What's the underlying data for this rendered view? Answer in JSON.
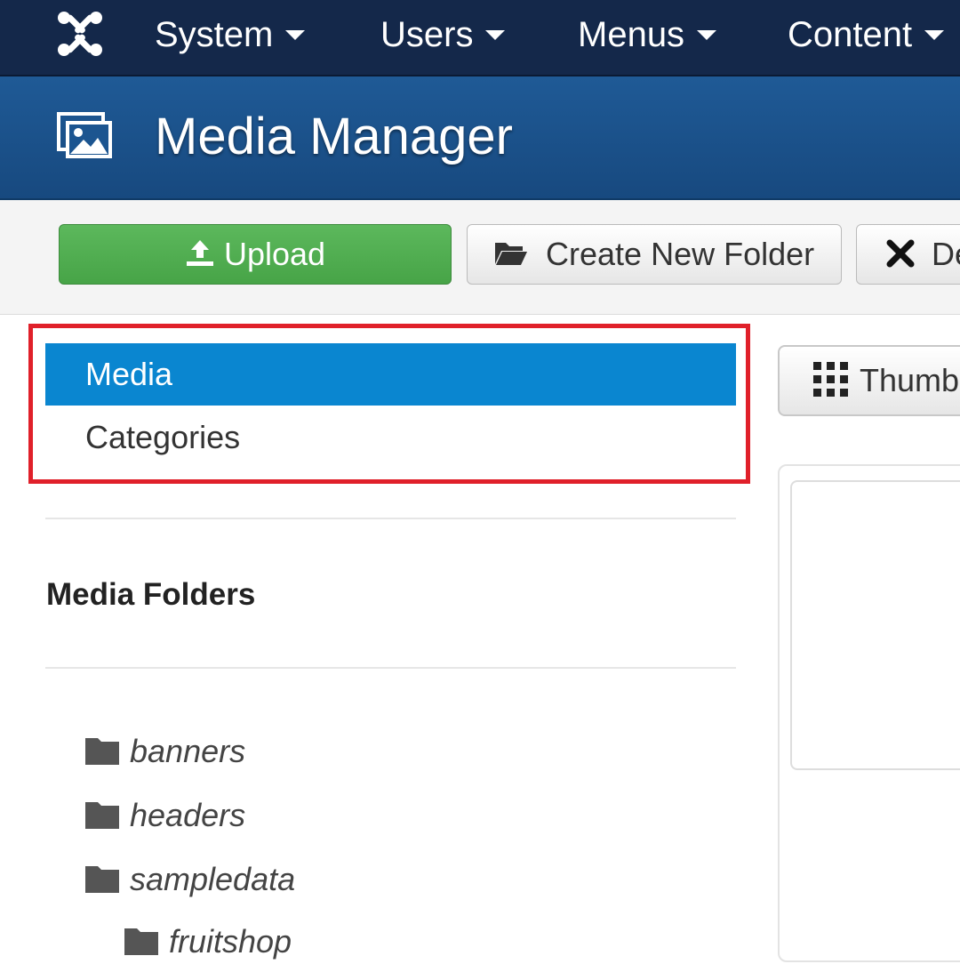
{
  "navbar": {
    "logo_icon": "joomla-logo-icon",
    "items": [
      {
        "label": "System"
      },
      {
        "label": "Users"
      },
      {
        "label": "Menus"
      },
      {
        "label": "Content"
      }
    ]
  },
  "header": {
    "icon": "image-icon",
    "title": "Media Manager"
  },
  "toolbar": {
    "upload_label": "Upload",
    "create_folder_label": "Create New Folder",
    "delete_label": "De"
  },
  "sidebar": {
    "items": [
      {
        "label": "Media",
        "active": true
      },
      {
        "label": "Categories",
        "active": false
      }
    ],
    "folders_heading": "Media Folders",
    "folders": [
      {
        "label": "banners"
      },
      {
        "label": "headers"
      },
      {
        "label": "sampledata"
      },
      {
        "label": "fruitshop"
      }
    ]
  },
  "main": {
    "view_button_label": "Thumb"
  },
  "colors": {
    "navbar": "#14284a",
    "titlebar": "#1a5088",
    "upload_green": "#5cb85c",
    "active_blue": "#0a86d0",
    "highlight_red": "#e0202a"
  }
}
